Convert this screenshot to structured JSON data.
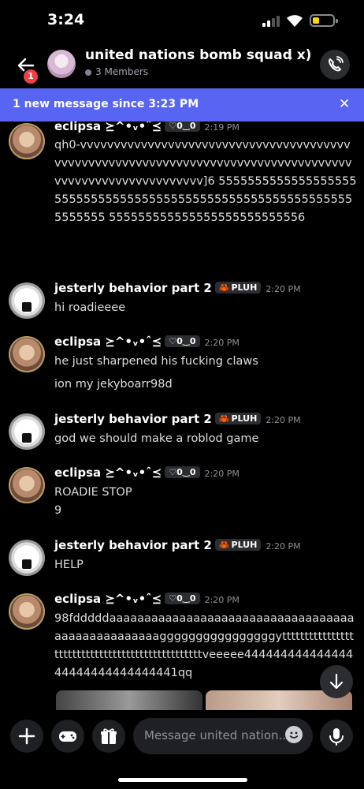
{
  "status": {
    "time": "3:24"
  },
  "header": {
    "back_badge": "1",
    "title": "united nations bomb squad x)",
    "members": "3 Members"
  },
  "banner": {
    "text": "1 new message since 3:23 PM",
    "close": "✕"
  },
  "messages": [
    {
      "name": "eclipsa ⪰^•ᵥ•ˆ⪯",
      "tag": "♡0‿0",
      "time": "2:19 PM",
      "lines": [
        "qh0-vvvvvvvvvvvvvvvvvvvvvvvvvvvvvvvvvvvvvvvvvvvvvvvvvvvvvvvvvvvvvvvvvvvvvvvvvvvvvvvvvvvvvvvvvvvvvvvvvvvvvvvvvv]6 5555555555555555555555555555555555555555555555555555555555555555555 555555555555555555555555556"
      ]
    },
    {
      "name": "jesterly behavior part 2",
      "tag": "PLUH",
      "time": "2:20 PM",
      "lines": [
        "hi roadieeee"
      ]
    },
    {
      "name": "eclipsa ⪰^•ᵥ•ˆ⪯",
      "tag": "♡0‿0",
      "time": "2:20 PM",
      "lines": [
        "he just sharpened his fucking claws",
        "ion my jekyboarr98d"
      ]
    },
    {
      "name": "jesterly behavior part 2",
      "tag": "PLUH",
      "time": "2:20 PM",
      "lines": [
        "god we should make a roblod game"
      ]
    },
    {
      "name": "eclipsa ⪰^•ᵥ•ˆ⪯",
      "tag": "♡0‿0",
      "time": "2:20 PM",
      "lines": [
        "ROADIE STOP",
        "9"
      ]
    },
    {
      "name": "jesterly behavior part 2",
      "tag": "PLUH",
      "time": "2:20 PM",
      "lines": [
        "HELP"
      ]
    },
    {
      "name": "eclipsa ⪰^•ᵥ•ˆ⪯",
      "tag": "♡0‿0",
      "time": "2:20 PM",
      "lines": [
        "98fdddddaaaaaaaaaaaaaaaaaaaaaaaaaaaaaaaaaaaaaaaaaaaaaaaaaaggggggggggggggggytttttttttttttttttttttttttttttttttttttttttttttttttveeeee44444444444444444444444444444441qq"
      ]
    }
  ],
  "composer": {
    "placeholder": "Message united nation..."
  },
  "icons": {
    "back": "arrow-left-icon",
    "call": "phone-call-icon",
    "add": "plus-icon",
    "games": "gamepad-icon",
    "gift": "gift-icon",
    "emoji": "emoji-icon",
    "mic": "microphone-icon",
    "scroll": "arrow-down-icon"
  },
  "colors": {
    "accent": "#5865f2",
    "badge": "#f23f43",
    "background": "#000000"
  }
}
